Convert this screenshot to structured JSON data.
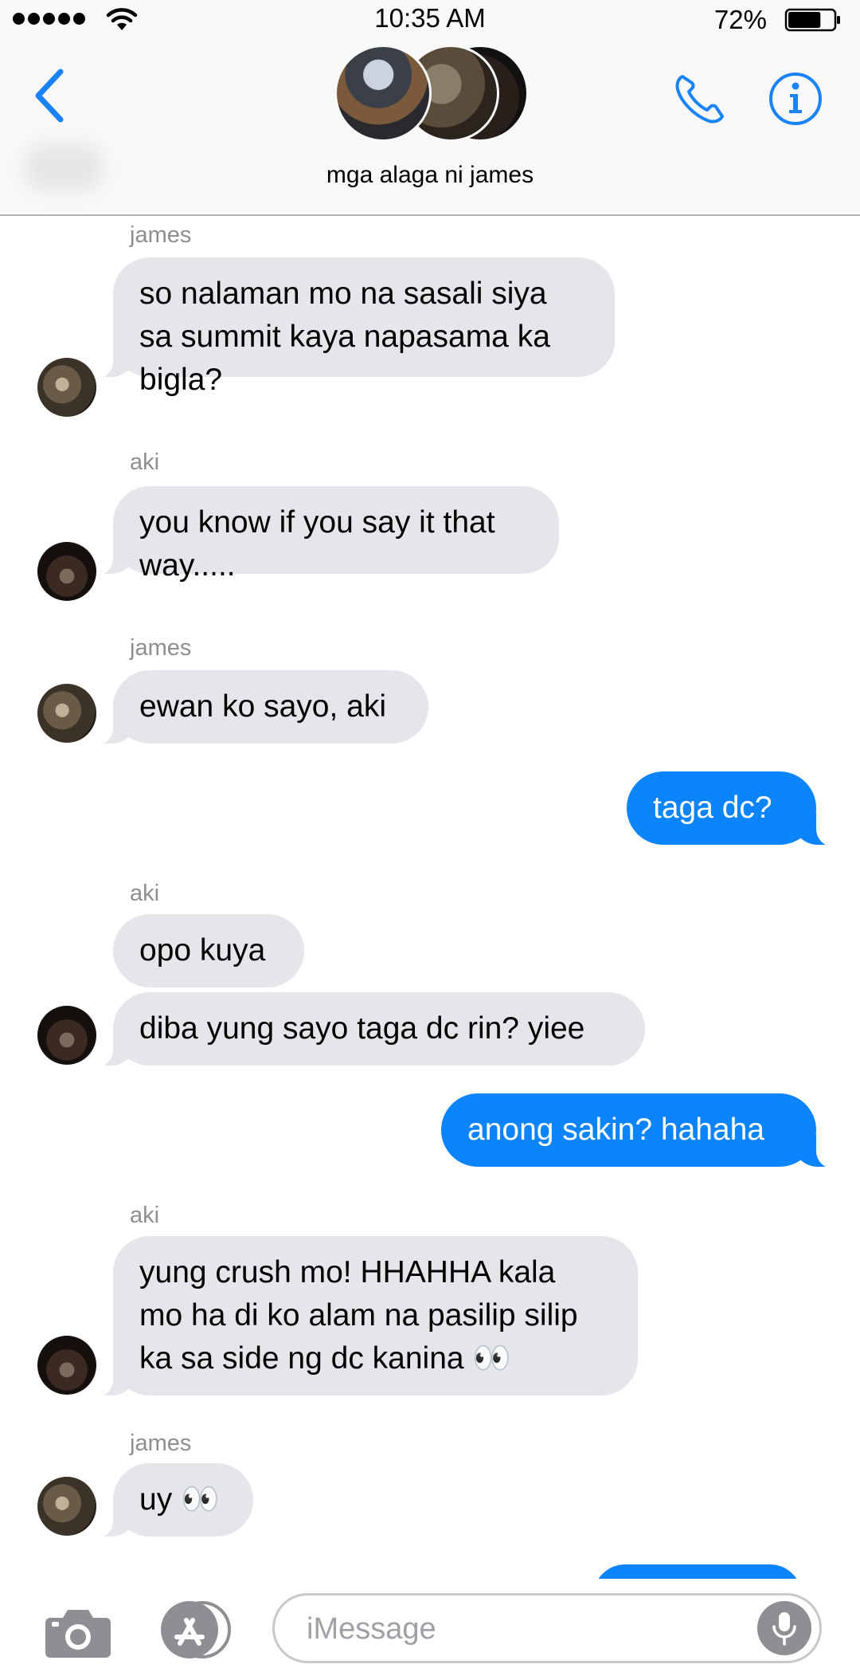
{
  "status_bar": {
    "time": "10:35 AM",
    "battery_percent": "72%",
    "battery_level": 0.72,
    "signal_bars": 5
  },
  "header": {
    "group_name": "mga alaga ni james",
    "accent_color": "#1a83f7"
  },
  "thread": {
    "incoming_color": "#e5e5ea",
    "outgoing_color": "#0b84fe",
    "blocks": [
      {
        "sender": "james",
        "messages": [
          "so nalaman mo na sasali siya\nsa summit kaya napasama ka\nbigla?"
        ]
      },
      {
        "sender": "aki",
        "messages": [
          "you know if you say it that\nway....."
        ]
      },
      {
        "sender": "james",
        "messages": [
          "ewan ko sayo, aki"
        ]
      },
      {
        "sender": "me",
        "messages": [
          "taga dc?"
        ]
      },
      {
        "sender": "aki",
        "messages": [
          "opo kuya",
          "diba yung sayo taga dc rin? yiee"
        ]
      },
      {
        "sender": "me",
        "messages": [
          "anong sakin? hahaha"
        ]
      },
      {
        "sender": "aki",
        "messages": [
          "yung crush mo! HHAHHA kala\nmo ha di ko alam na pasilip silip\nka sa side ng dc kanina 👀"
        ]
      },
      {
        "sender": "james",
        "messages": [
          "uy 👀"
        ]
      }
    ]
  },
  "composer": {
    "placeholder": "iMessage",
    "value": ""
  }
}
